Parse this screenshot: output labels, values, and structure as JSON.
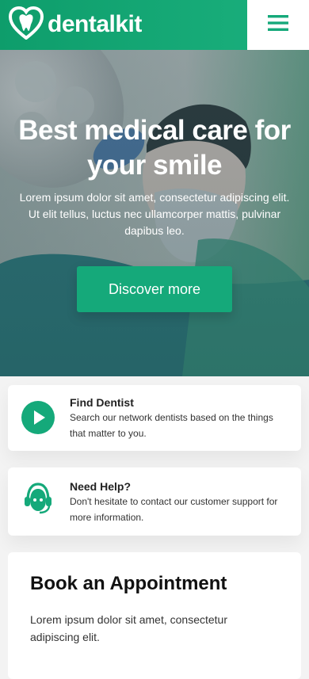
{
  "header": {
    "brand": "dentalkit",
    "colors": {
      "primary": "#15a97a",
      "header_gradient_start": "#0e9d6b",
      "header_gradient_end": "#1bb17e"
    },
    "menu_icon": "hamburger-icon",
    "logo_icon": "tooth-heart-icon"
  },
  "hero": {
    "title": "Best medical care for your smile",
    "text": "Lorem ipsum dolor sit amet, consectetur adipiscing elit. Ut elit tellus, luctus nec ullamcorper mattis, pulvinar dapibus leo.",
    "button": "Discover more"
  },
  "features": [
    {
      "icon": "play-circle-icon",
      "title": "Find Dentist",
      "description": "Search our network dentists based on the things that matter to you."
    },
    {
      "icon": "support-agent-icon",
      "title": "Need Help?",
      "description": "Don't hesitate to contact our customer support for more information."
    }
  ],
  "appointment": {
    "title": "Book an Appointment",
    "text": "Lorem ipsum dolor sit amet, consectetur adipiscing elit."
  }
}
